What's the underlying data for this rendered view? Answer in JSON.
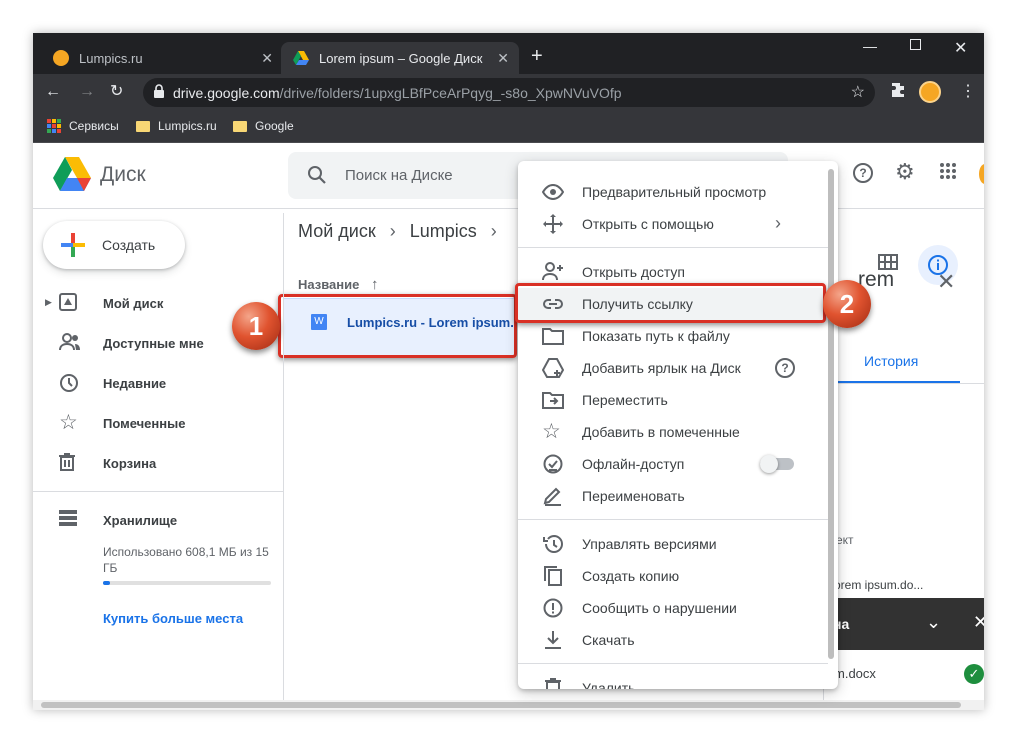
{
  "tabs": [
    {
      "title": "Lumpics.ru"
    },
    {
      "title": "Lorem ipsum – Google Диск"
    }
  ],
  "address": {
    "host": "drive.google.com",
    "path": "/drive/folders/1upxgLBfPceArPqyg_-s8o_XpwNVuVOfp"
  },
  "bookmarks": [
    {
      "label": "Сервисы"
    },
    {
      "label": "Lumpics.ru"
    },
    {
      "label": "Google"
    }
  ],
  "drive": {
    "brand": "Диск",
    "search_placeholder": "Поиск на Диске",
    "create_label": "Создать",
    "nav": [
      {
        "label": "Мой диск"
      },
      {
        "label": "Доступные мне"
      },
      {
        "label": "Недавние"
      },
      {
        "label": "Помеченные"
      },
      {
        "label": "Корзина"
      }
    ],
    "storage": {
      "label": "Хранилище",
      "usage": "Использовано 608,1 МБ из 15 ГБ",
      "fraction": 0.04,
      "buy": "Купить больше места"
    },
    "breadcrumb": [
      "Мой диск",
      "Lumpics"
    ],
    "column_name": "Название",
    "file": {
      "name": "Lumpics.ru - Lorem ipsum.d",
      "icon_letter": "W"
    },
    "right_panel": {
      "title_fragment": "rem",
      "tab": "История",
      "text1": "ект",
      "text2": "orem ipsum.do..."
    },
    "upload": {
      "header": "на",
      "file": "m.docx"
    }
  },
  "menu": {
    "items": [
      {
        "label": "Предварительный просмотр"
      },
      {
        "label": "Открыть с помощью"
      },
      {
        "label": "Открыть доступ"
      },
      {
        "label": "Получить ссылку"
      },
      {
        "label": "Показать путь к файлу"
      },
      {
        "label": "Добавить ярлык на Диск"
      },
      {
        "label": "Переместить"
      },
      {
        "label": "Добавить в помеченные"
      },
      {
        "label": "Офлайн-доступ"
      },
      {
        "label": "Переименовать"
      },
      {
        "label": "Управлять версиями"
      },
      {
        "label": "Создать копию"
      },
      {
        "label": "Сообщить о нарушении"
      },
      {
        "label": "Скачать"
      },
      {
        "label": "Удалить"
      }
    ]
  },
  "annotations": {
    "step1": "1",
    "step2": "2"
  },
  "colors": {
    "accent": "#1a73e8",
    "highlight": "#d93025"
  }
}
